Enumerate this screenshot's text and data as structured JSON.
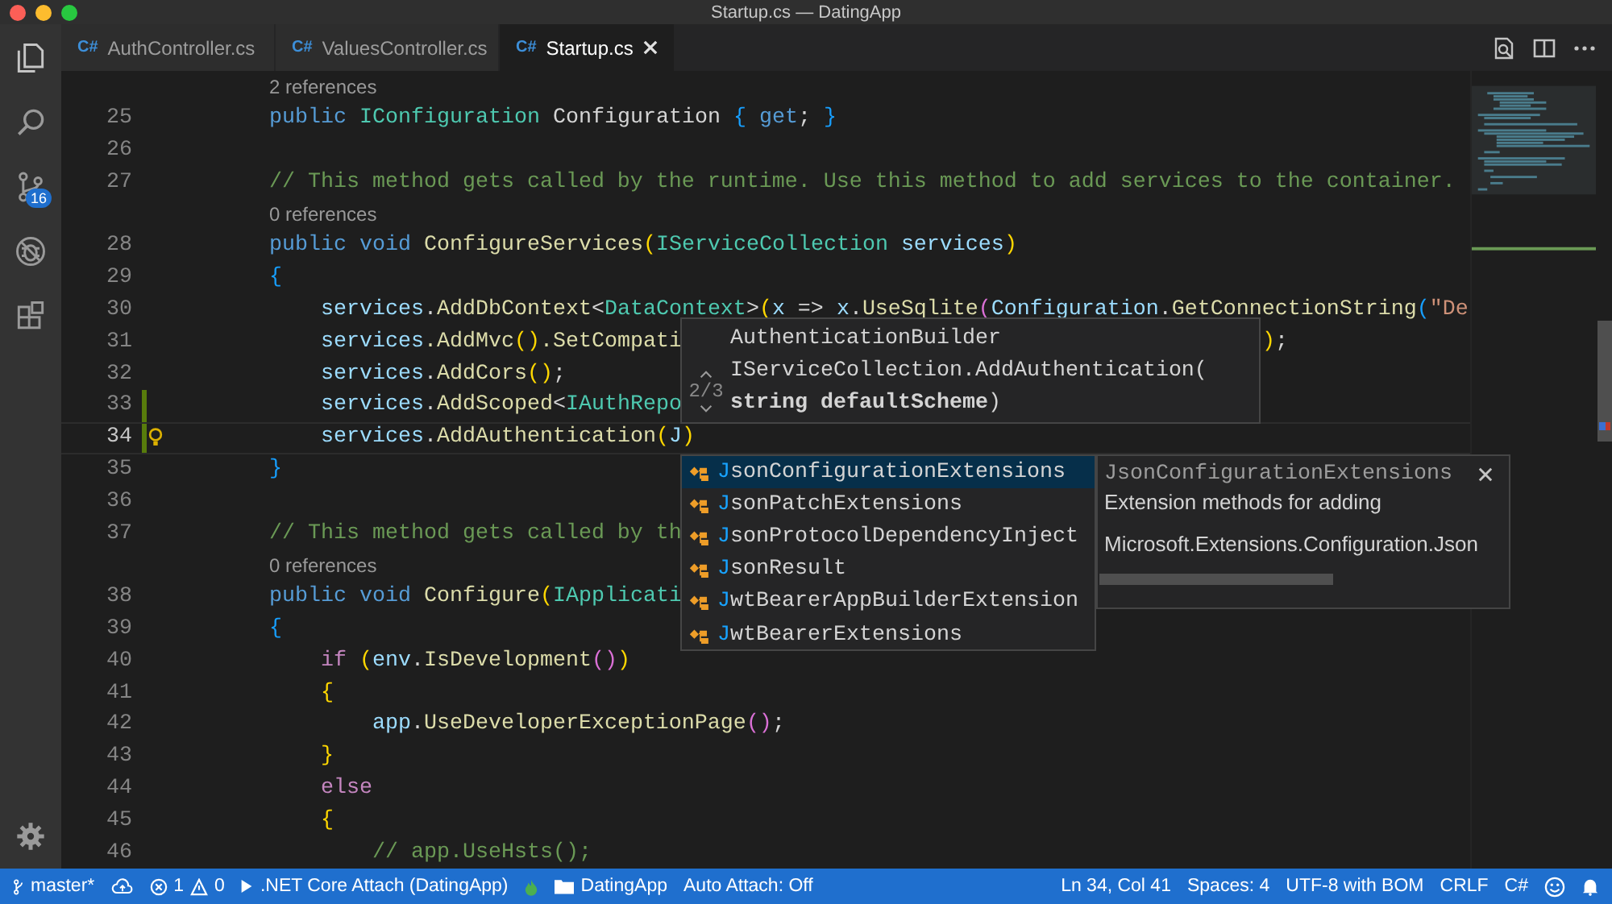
{
  "window": {
    "title": "Startup.cs — DatingApp"
  },
  "activity_bar": {
    "source_control_badge": "16"
  },
  "tabs": [
    {
      "language": "C#",
      "label": "AuthController.cs",
      "selected": false
    },
    {
      "language": "C#",
      "label": "ValuesController.cs",
      "selected": false
    },
    {
      "language": "C#",
      "label": "Startup.cs",
      "selected": true
    }
  ],
  "editor": {
    "rows": [
      {
        "kind": "lens",
        "text": "2 references"
      },
      {
        "kind": "code",
        "number": "25",
        "changed": false,
        "current": false,
        "lightbulb": false,
        "tokens": [
          {
            "kind": "kw",
            "t": "        public "
          },
          {
            "kind": "type",
            "t": "IConfiguration "
          },
          {
            "kind": "pl",
            "t": "Configuration "
          },
          {
            "kind": "b3",
            "t": "{ "
          },
          {
            "kind": "kw",
            "t": "get"
          },
          {
            "kind": "pl",
            "t": "; "
          },
          {
            "kind": "b3",
            "t": "}"
          }
        ]
      },
      {
        "kind": "code",
        "number": "26",
        "changed": false,
        "current": false,
        "lightbulb": false
      },
      {
        "kind": "code",
        "number": "27",
        "changed": false,
        "current": false,
        "lightbulb": false,
        "tokens": [
          {
            "kind": "cm",
            "t": "        // This method gets called by the runtime. Use this method to add services to the container."
          }
        ]
      },
      {
        "kind": "lens",
        "text": "0 references"
      },
      {
        "kind": "code",
        "number": "28",
        "changed": false,
        "current": false,
        "lightbulb": false,
        "tokens": [
          {
            "kind": "kw",
            "t": "        public "
          },
          {
            "kind": "kw",
            "t": "void "
          },
          {
            "kind": "fn",
            "t": "ConfigureServices"
          },
          {
            "kind": "b1",
            "t": "("
          },
          {
            "kind": "type",
            "t": "IServiceCollection "
          },
          {
            "kind": "var",
            "t": "services"
          },
          {
            "kind": "b1",
            "t": ")"
          }
        ]
      },
      {
        "kind": "code",
        "number": "29",
        "changed": false,
        "current": false,
        "lightbulb": false,
        "tokens": [
          {
            "kind": "b3",
            "t": "        {"
          }
        ]
      },
      {
        "kind": "code",
        "number": "30",
        "changed": false,
        "current": false,
        "lightbulb": false,
        "tokens": [
          {
            "kind": "var",
            "t": "            services"
          },
          {
            "kind": "pl",
            "t": "."
          },
          {
            "kind": "fn",
            "t": "AddDbContext"
          },
          {
            "kind": "pl",
            "t": "<"
          },
          {
            "kind": "type",
            "t": "DataContext"
          },
          {
            "kind": "pl",
            "t": ">"
          },
          {
            "kind": "b1",
            "t": "("
          },
          {
            "kind": "var",
            "t": "x"
          },
          {
            "kind": "pl",
            "t": " => "
          },
          {
            "kind": "var",
            "t": "x"
          },
          {
            "kind": "pl",
            "t": "."
          },
          {
            "kind": "fn",
            "t": "UseSqlite"
          },
          {
            "kind": "b2",
            "t": "("
          },
          {
            "kind": "var",
            "t": "Configuration"
          },
          {
            "kind": "pl",
            "t": "."
          },
          {
            "kind": "fn",
            "t": "GetConnectionString"
          },
          {
            "kind": "b3",
            "t": "("
          },
          {
            "kind": "str",
            "t": "\"De"
          }
        ]
      },
      {
        "kind": "code",
        "number": "31",
        "changed": false,
        "current": false,
        "lightbulb": false,
        "tokens": [
          {
            "kind": "var",
            "t": "            services"
          },
          {
            "kind": "fn",
            "t": ".AddMvc"
          },
          {
            "kind": "b1",
            "t": "()"
          },
          {
            "kind": "fn",
            "t": ".SetCompati"
          }
        ],
        "tail": [
          {
            "kind": "b1",
            "t": ")"
          },
          {
            "kind": "pl",
            "t": ";"
          }
        ]
      },
      {
        "kind": "code",
        "number": "32",
        "changed": false,
        "current": false,
        "lightbulb": false,
        "tokens": [
          {
            "kind": "var",
            "t": "            services"
          },
          {
            "kind": "pl",
            "t": "."
          },
          {
            "kind": "fn",
            "t": "AddCors"
          },
          {
            "kind": "b1",
            "t": "()"
          },
          {
            "kind": "pl",
            "t": ";"
          }
        ]
      },
      {
        "kind": "code",
        "number": "33",
        "changed": true,
        "current": false,
        "lightbulb": false,
        "tokens": [
          {
            "kind": "var",
            "t": "            services"
          },
          {
            "kind": "pl",
            "t": "."
          },
          {
            "kind": "fn",
            "t": "AddScoped"
          },
          {
            "kind": "pl",
            "t": "<"
          },
          {
            "kind": "type",
            "t": "IAuthRepo"
          }
        ]
      },
      {
        "kind": "code",
        "number": "34",
        "changed": true,
        "current": true,
        "lightbulb": true,
        "tokens": [
          {
            "kind": "var",
            "t": "            services"
          },
          {
            "kind": "pl",
            "t": "."
          },
          {
            "kind": "fn",
            "t": "AddAuthentication"
          },
          {
            "kind": "b1",
            "t": "("
          },
          {
            "kind": "var",
            "t": "J"
          },
          {
            "kind": "b1",
            "t": ")"
          }
        ]
      },
      {
        "kind": "code",
        "number": "35",
        "changed": false,
        "current": false,
        "lightbulb": false,
        "tokens": [
          {
            "kind": "b3",
            "t": "        }"
          }
        ]
      },
      {
        "kind": "code",
        "number": "36",
        "changed": false,
        "current": false,
        "lightbulb": false
      },
      {
        "kind": "code",
        "number": "37",
        "changed": false,
        "current": false,
        "lightbulb": false,
        "tokens": [
          {
            "kind": "cm",
            "t": "        // This method gets called by th"
          }
        ]
      },
      {
        "kind": "lens",
        "text": "0 references"
      },
      {
        "kind": "code",
        "number": "38",
        "changed": false,
        "current": false,
        "lightbulb": false,
        "tokens": [
          {
            "kind": "kw",
            "t": "        public "
          },
          {
            "kind": "kw",
            "t": "void "
          },
          {
            "kind": "fn",
            "t": "Configure"
          },
          {
            "kind": "b1",
            "t": "("
          },
          {
            "kind": "type",
            "t": "IApplicati"
          }
        ]
      },
      {
        "kind": "code",
        "number": "39",
        "changed": false,
        "current": false,
        "lightbulb": false,
        "tokens": [
          {
            "kind": "b3",
            "t": "        {"
          }
        ]
      },
      {
        "kind": "code",
        "number": "40",
        "changed": false,
        "current": false,
        "lightbulb": false,
        "tokens": [
          {
            "kind": "ctl",
            "t": "            if "
          },
          {
            "kind": "b1",
            "t": "("
          },
          {
            "kind": "var",
            "t": "env"
          },
          {
            "kind": "pl",
            "t": "."
          },
          {
            "kind": "fn",
            "t": "IsDevelopment"
          },
          {
            "kind": "b2",
            "t": "()"
          },
          {
            "kind": "b1",
            "t": ")"
          }
        ]
      },
      {
        "kind": "code",
        "number": "41",
        "changed": false,
        "current": false,
        "lightbulb": false,
        "tokens": [
          {
            "kind": "b1",
            "t": "            {"
          }
        ]
      },
      {
        "kind": "code",
        "number": "42",
        "changed": false,
        "current": false,
        "lightbulb": false,
        "tokens": [
          {
            "kind": "var",
            "t": "                app"
          },
          {
            "kind": "pl",
            "t": "."
          },
          {
            "kind": "fn",
            "t": "UseDeveloperExceptionPage"
          },
          {
            "kind": "b2",
            "t": "()"
          },
          {
            "kind": "pl",
            "t": ";"
          }
        ]
      },
      {
        "kind": "code",
        "number": "43",
        "changed": false,
        "current": false,
        "lightbulb": false,
        "tokens": [
          {
            "kind": "b1",
            "t": "            }"
          }
        ]
      },
      {
        "kind": "code",
        "number": "44",
        "changed": false,
        "current": false,
        "lightbulb": false,
        "tokens": [
          {
            "kind": "ctl",
            "t": "            else"
          }
        ]
      },
      {
        "kind": "code",
        "number": "45",
        "changed": false,
        "current": false,
        "lightbulb": false,
        "tokens": [
          {
            "kind": "b1",
            "t": "            {"
          }
        ]
      },
      {
        "kind": "code",
        "number": "46",
        "changed": false,
        "current": false,
        "lightbulb": false,
        "tokens": [
          {
            "kind": "cm",
            "t": "                // app.UseHsts();"
          }
        ]
      }
    ]
  },
  "parameter_hint": {
    "counter": "2/3",
    "lines": [
      "AuthenticationBuilder",
      "IServiceCollection.AddAuthentication(",
      "**string defaultScheme**)"
    ]
  },
  "suggestions": [
    {
      "match": "J",
      "rest": "sonConfigurationExtensions",
      "selected": true
    },
    {
      "match": "J",
      "rest": "sonPatchExtensions",
      "selected": false
    },
    {
      "match": "J",
      "rest": "sonProtocolDependencyInject",
      "selected": false
    },
    {
      "match": "J",
      "rest": "sonResult",
      "selected": false
    },
    {
      "match": "J",
      "rest": "wtBearerAppBuilderExtension",
      "selected": false
    },
    {
      "match": "J",
      "rest": "wtBearerExtensions",
      "selected": false
    }
  ],
  "details": {
    "title": "JsonConfigurationExtensions",
    "lines": [
      "Extension methods for adding",
      "Microsoft.Extensions.Configuration.Json"
    ]
  },
  "status_bar": {
    "branch": "master*",
    "errors": "1",
    "warnings": "0",
    "debug": ".NET Core Attach (DatingApp)",
    "folder": "DatingApp",
    "auto_attach": "Auto Attach: Off",
    "right": [
      "Ln 34, Col 41",
      "Spaces: 4",
      "UTF-8 with BOM",
      "CRLF",
      "C#"
    ]
  }
}
